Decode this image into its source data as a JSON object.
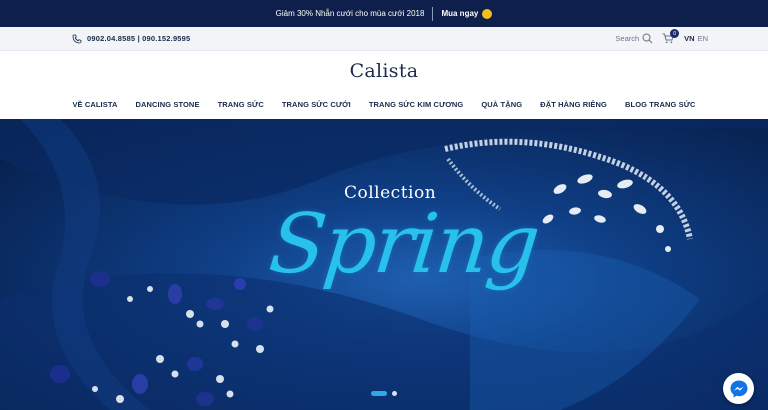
{
  "promo": {
    "text": "Giảm 30% Nhẫn cưới cho mùa cưới 2018",
    "cta_label": "Mua ngay",
    "accent_color": "#f2c01e",
    "background_color": "#0f1f4b"
  },
  "utility": {
    "phones": "0902.04.8585 | 090.152.9595",
    "search_label": "Search",
    "cart_count": "0",
    "languages": [
      "VN",
      "EN"
    ]
  },
  "header": {
    "logo": "Calista"
  },
  "nav": {
    "items": [
      "VỀ CALISTA",
      "DANCING STONE",
      "TRANG SỨC",
      "TRANG SỨC CƯỚI",
      "TRANG SỨC KIM CƯƠNG",
      "QUÀ TẶNG",
      "ĐẶT HÀNG RIÊNG",
      "BLOG TRANG SỨC"
    ]
  },
  "hero": {
    "collection_label": "Collection",
    "title": "Spring",
    "slides": 2,
    "active_slide": 1,
    "title_color": "#27c1ec"
  },
  "icons": [
    "phone-icon",
    "search-icon",
    "cart-icon",
    "messenger-icon"
  ]
}
